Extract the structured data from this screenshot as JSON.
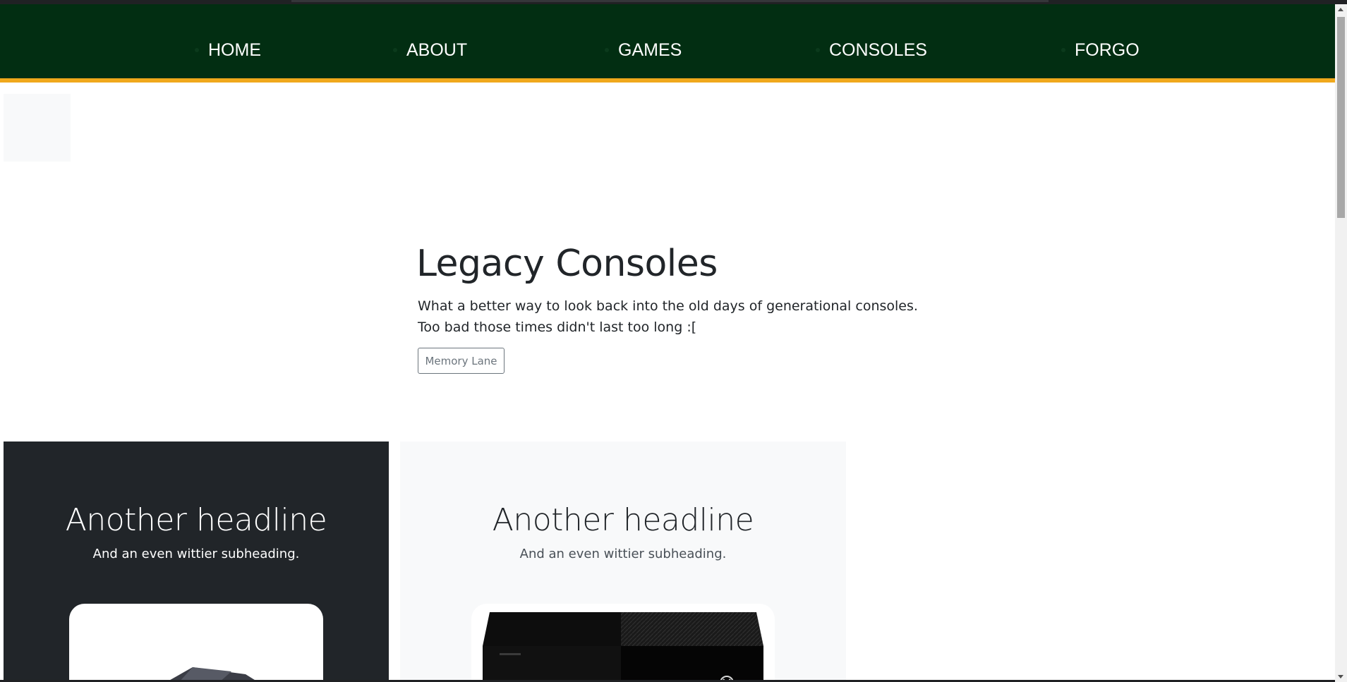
{
  "navbar": {
    "items": [
      {
        "label": "HOME"
      },
      {
        "label": "ABOUT"
      },
      {
        "label": "GAMES"
      },
      {
        "label": "CONSOLES"
      },
      {
        "label": "FORGO"
      }
    ]
  },
  "hero": {
    "title": "Legacy Consoles",
    "lead": "What a better way to look back into the old days of generational consoles. Too bad those times didn't last too long :[",
    "button_label": "Memory Lane"
  },
  "panels": [
    {
      "headline": "Another headline",
      "subheading": "And an even wittier subheading."
    },
    {
      "headline": "Another headline",
      "subheading": "And an even wittier subheading."
    }
  ],
  "images": {
    "panel_1": "game-console-image",
    "panel_2": "xbox-one-console-image"
  },
  "colors": {
    "navbar_bg": "#022e12",
    "navbar_accent": "#f0a81c",
    "dark_panel": "#212529",
    "light_panel": "#f8f9fa",
    "button_outline": "#6c757d"
  }
}
